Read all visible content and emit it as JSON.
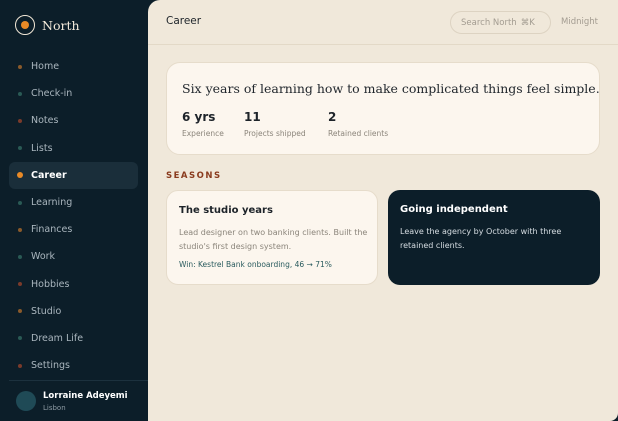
{
  "brand": {
    "name": "North",
    "accent": "#e98a26"
  },
  "sidebar": {
    "items": [
      {
        "label": "Home",
        "color": "#8a5a2b"
      },
      {
        "label": "Check-in",
        "color": "#2a5a55"
      },
      {
        "label": "Notes",
        "color": "#7a3a2a"
      },
      {
        "label": "Lists",
        "color": "#2a5a55"
      },
      {
        "label": "Career",
        "color": "#e98a26",
        "active": true
      },
      {
        "label": "Learning",
        "color": "#2a5a55"
      },
      {
        "label": "Finances",
        "color": "#8a5a2b"
      },
      {
        "label": "Work",
        "color": "#2a5a55"
      },
      {
        "label": "Hobbies",
        "color": "#7a3a2a"
      },
      {
        "label": "Studio",
        "color": "#8a5a2b"
      },
      {
        "label": "Dream Life",
        "color": "#2a5a55"
      },
      {
        "label": "Settings",
        "color": "#7a3a2a"
      }
    ]
  },
  "profile": {
    "name": "Lorraine Adeyemi",
    "city": "Lisbon"
  },
  "header": {
    "title": "Career",
    "search_placeholder": "Search North",
    "search_shortcut": "⌘K",
    "theme_label": "Midnight"
  },
  "hero": {
    "quote": "Six years of learning how to make complicated things feel simple.",
    "stats": [
      {
        "value": "6 yrs",
        "label": "Experience"
      },
      {
        "value": "11",
        "label": "Projects shipped"
      },
      {
        "value": "2",
        "label": "Retained clients"
      }
    ]
  },
  "seasons": {
    "label": "SEASONS",
    "cards": [
      {
        "title": "The studio years",
        "body": "Lead designer on two banking clients. Built the studio's first design system.",
        "win": "Win: Kestrel Bank onboarding, 46 → 71%"
      },
      {
        "title": "Going independent",
        "body": "Leave the agency by October with three retained clients."
      }
    ]
  }
}
